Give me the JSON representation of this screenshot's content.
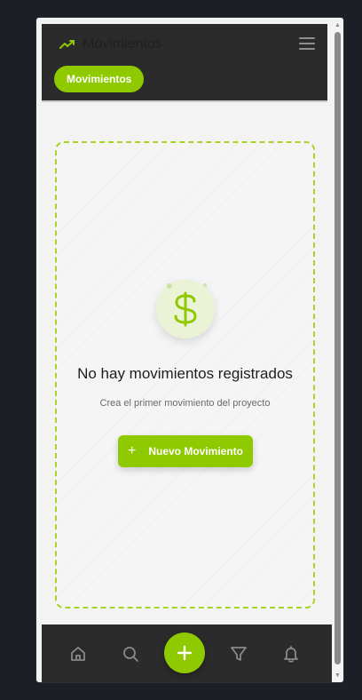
{
  "header": {
    "title": "Movimientos",
    "tab_label": "Movimientos"
  },
  "empty_state": {
    "title": "No hay movimientos registrados",
    "subtitle": "Crea el primer movimiento del proyecto",
    "button_label": "Nuevo Movimiento",
    "button_icon": "plus-icon",
    "illustration_icon": "dollar-icon"
  },
  "bottom_nav": {
    "items": [
      {
        "icon": "home-icon"
      },
      {
        "icon": "search-icon"
      },
      {
        "icon": "plus-icon"
      },
      {
        "icon": "filter-icon"
      },
      {
        "icon": "bell-icon"
      }
    ]
  },
  "colors": {
    "accent": "#8fc900",
    "header_bg": "#2b2b2b",
    "page_bg": "#1c1f26"
  }
}
